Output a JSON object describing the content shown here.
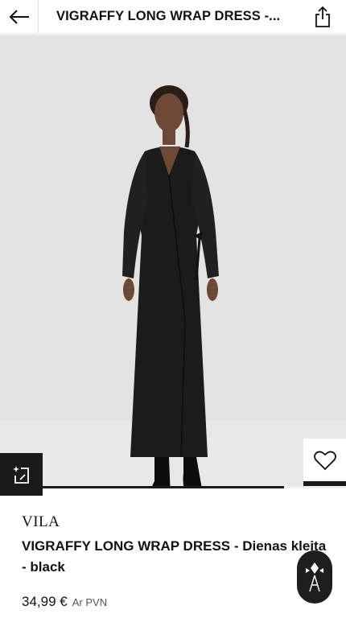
{
  "header": {
    "title": "VIGRAFFY LONG WRAP DRESS  -...",
    "back_icon": "arrow-left-icon",
    "share_icon": "share-icon"
  },
  "gallery": {
    "image_alt": "Model wearing black long wrap dress",
    "progress_fraction": 0.82,
    "wishlist_icon": "heart-icon",
    "bag_icon": "shopping-bag-icon",
    "size_icon": "sparkle-resize-icon"
  },
  "product": {
    "brand": "VILA",
    "name": "VIGRAFFY LONG WRAP DRESS  - Dienas kleita - black",
    "price": "34,99 €",
    "price_note": "Ar PVN"
  },
  "colors": {
    "accent": "#1a1a1a",
    "image_bg": "#e3e3e3"
  }
}
